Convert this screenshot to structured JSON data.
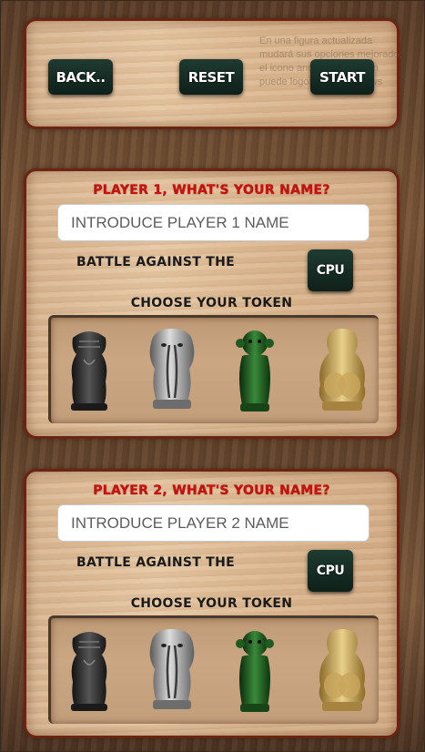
{
  "header": {
    "back_label": "BACK..",
    "reset_label": "RESET",
    "start_label": "START",
    "ghost_overlay": "En una figura actualizada mudará sus opciones mejorado, el icono anotación también puede logotipo de Windows"
  },
  "players": [
    {
      "title": "PLAYER 1, WHAT'S YOUR NAME?",
      "name_value": "",
      "name_placeholder": "INTRODUCE PLAYER 1 NAME",
      "battle_label": "BATTLE AGAINST THE",
      "opponent_button": "CPU",
      "token_label": "CHOOSE YOUR TOKEN",
      "tokens": [
        "black-rhino-token",
        "silver-elephant-token",
        "green-monkey-token",
        "gold-hippo-token"
      ]
    },
    {
      "title": "PLAYER 2, WHAT'S YOUR NAME?",
      "name_value": "",
      "name_placeholder": "INTRODUCE PLAYER 2 NAME",
      "battle_label": "BATTLE AGAINST THE",
      "opponent_button": "CPU",
      "token_label": "CHOOSE YOUR TOKEN",
      "tokens": [
        "black-rhino-token",
        "silver-elephant-token",
        "green-monkey-token",
        "gold-hippo-token"
      ]
    }
  ],
  "colors": {
    "title_red": "#c8100c",
    "button_green": "#1f3b31",
    "panel_border": "#6b2410"
  }
}
